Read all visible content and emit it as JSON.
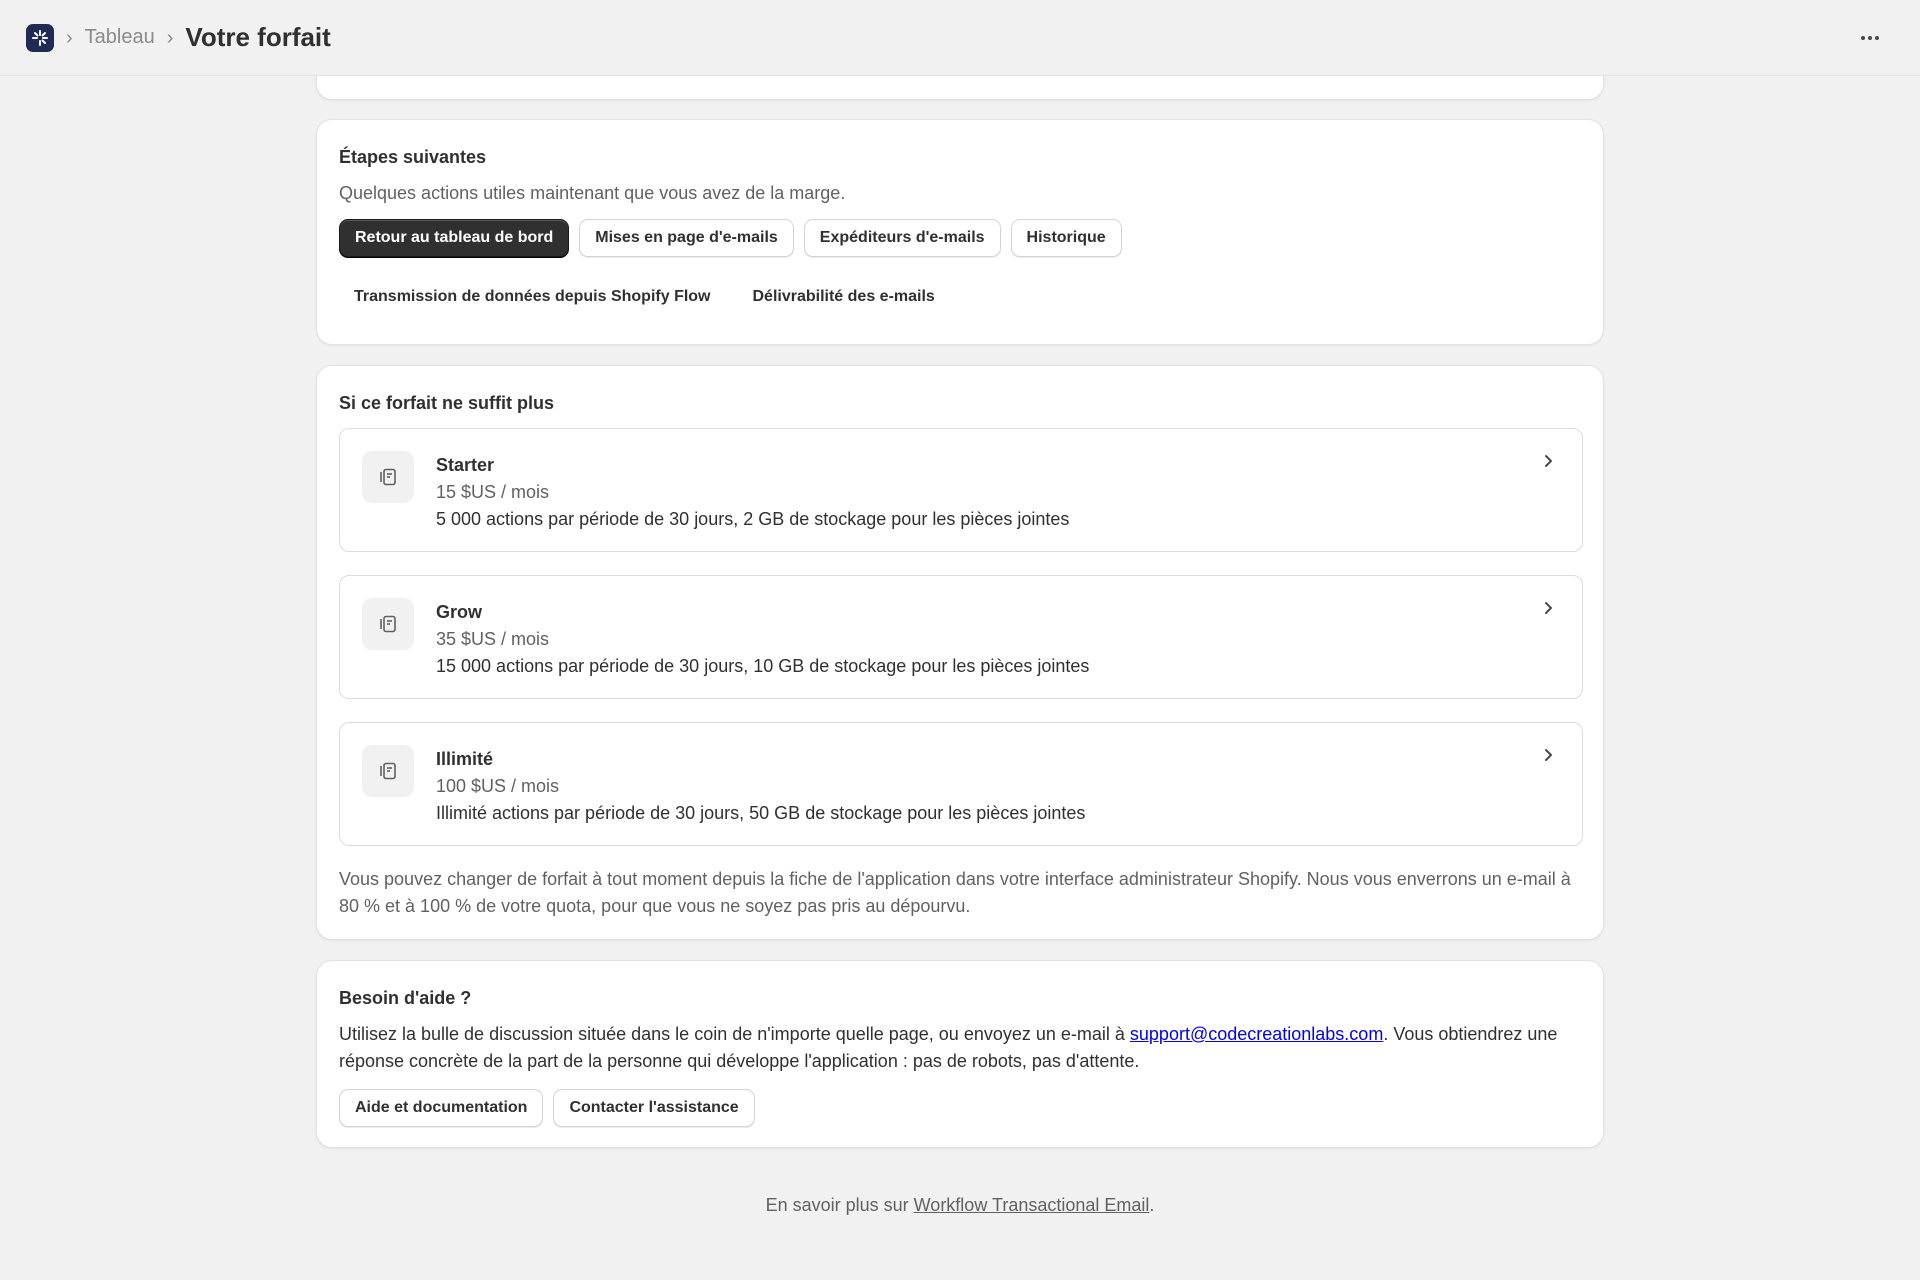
{
  "header": {
    "breadcrumb_parent": "Tableau",
    "breadcrumb_separator": "›",
    "title": "Votre forfait",
    "logo_icon": "sparkle-logo-icon",
    "more_icon": "more-horizontal-icon",
    "colors": {
      "logo_bg": "#1f2a55"
    }
  },
  "next_steps": {
    "title": "Étapes suivantes",
    "subtitle": "Quelques actions utiles maintenant que vous avez de la marge.",
    "buttons": [
      {
        "label": "Retour au tableau de bord",
        "variant": "primary"
      },
      {
        "label": "Mises en page d'e-mails",
        "variant": "secondary"
      },
      {
        "label": "Expéditeurs d'e-mails",
        "variant": "secondary"
      },
      {
        "label": "Historique",
        "variant": "secondary"
      },
      {
        "label": "Transmission de données depuis Shopify Flow",
        "variant": "plain"
      },
      {
        "label": "Délivrabilité des e-mails",
        "variant": "plain"
      }
    ]
  },
  "plans": {
    "title": "Si ce forfait ne suffit plus",
    "items": [
      {
        "name": "Starter",
        "price": "15 $US / mois",
        "description": "5 000 actions par période de 30 jours, 2 GB de stockage pour les pièces jointes",
        "icon": "plan-document-icon"
      },
      {
        "name": "Grow",
        "price": "35 $US / mois",
        "description": "15 000 actions par période de 30 jours, 10 GB de stockage pour les pièces jointes",
        "icon": "plan-document-icon"
      },
      {
        "name": "Illimité",
        "price": "100 $US / mois",
        "description": "Illimité actions par période de 30 jours, 50 GB de stockage pour les pièces jointes",
        "icon": "plan-document-icon"
      }
    ],
    "footnote": "Vous pouvez changer de forfait à tout moment depuis la fiche de l'application dans votre interface administrateur Shopify. Nous vous enverrons un e-mail à 80 % et à 100 % de votre quota, pour que vous ne soyez pas pris au dépourvu."
  },
  "help": {
    "title": "Besoin d'aide ?",
    "text_before": "Utilisez la bulle de discussion située dans le coin de n'importe quelle page, ou envoyez un e-mail à ",
    "email": "support@codecreationlabs.com",
    "text_after": ". Vous obtiendrez une réponse concrète de la part de la personne qui développe l'application : pas de robots, pas d'attente.",
    "buttons": {
      "docs": "Aide et documentation",
      "contact": "Contacter l'assistance"
    }
  },
  "footer": {
    "prefix": "En savoir plus sur ",
    "link": "Workflow Transactional Email",
    "suffix": "."
  }
}
